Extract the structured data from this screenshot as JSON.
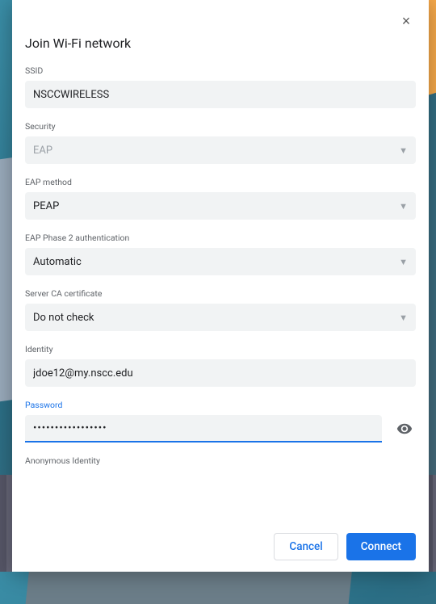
{
  "dialog": {
    "title": "Join Wi-Fi network",
    "closeLabel": "×"
  },
  "fields": {
    "ssid": {
      "label": "SSID",
      "value": "NSCCWIRELESS"
    },
    "security": {
      "label": "Security",
      "value": "EAP"
    },
    "eapMethod": {
      "label": "EAP method",
      "value": "PEAP"
    },
    "eapPhase2": {
      "label": "EAP Phase 2 authentication",
      "value": "Automatic"
    },
    "serverCa": {
      "label": "Server CA certificate",
      "value": "Do not check"
    },
    "identity": {
      "label": "Identity",
      "value": "jdoe12@my.nscc.edu"
    },
    "password": {
      "label": "Password",
      "value": "•••••••••••••••••"
    },
    "anonymous": {
      "label": "Anonymous Identity"
    }
  },
  "buttons": {
    "cancel": "Cancel",
    "connect": "Connect"
  }
}
